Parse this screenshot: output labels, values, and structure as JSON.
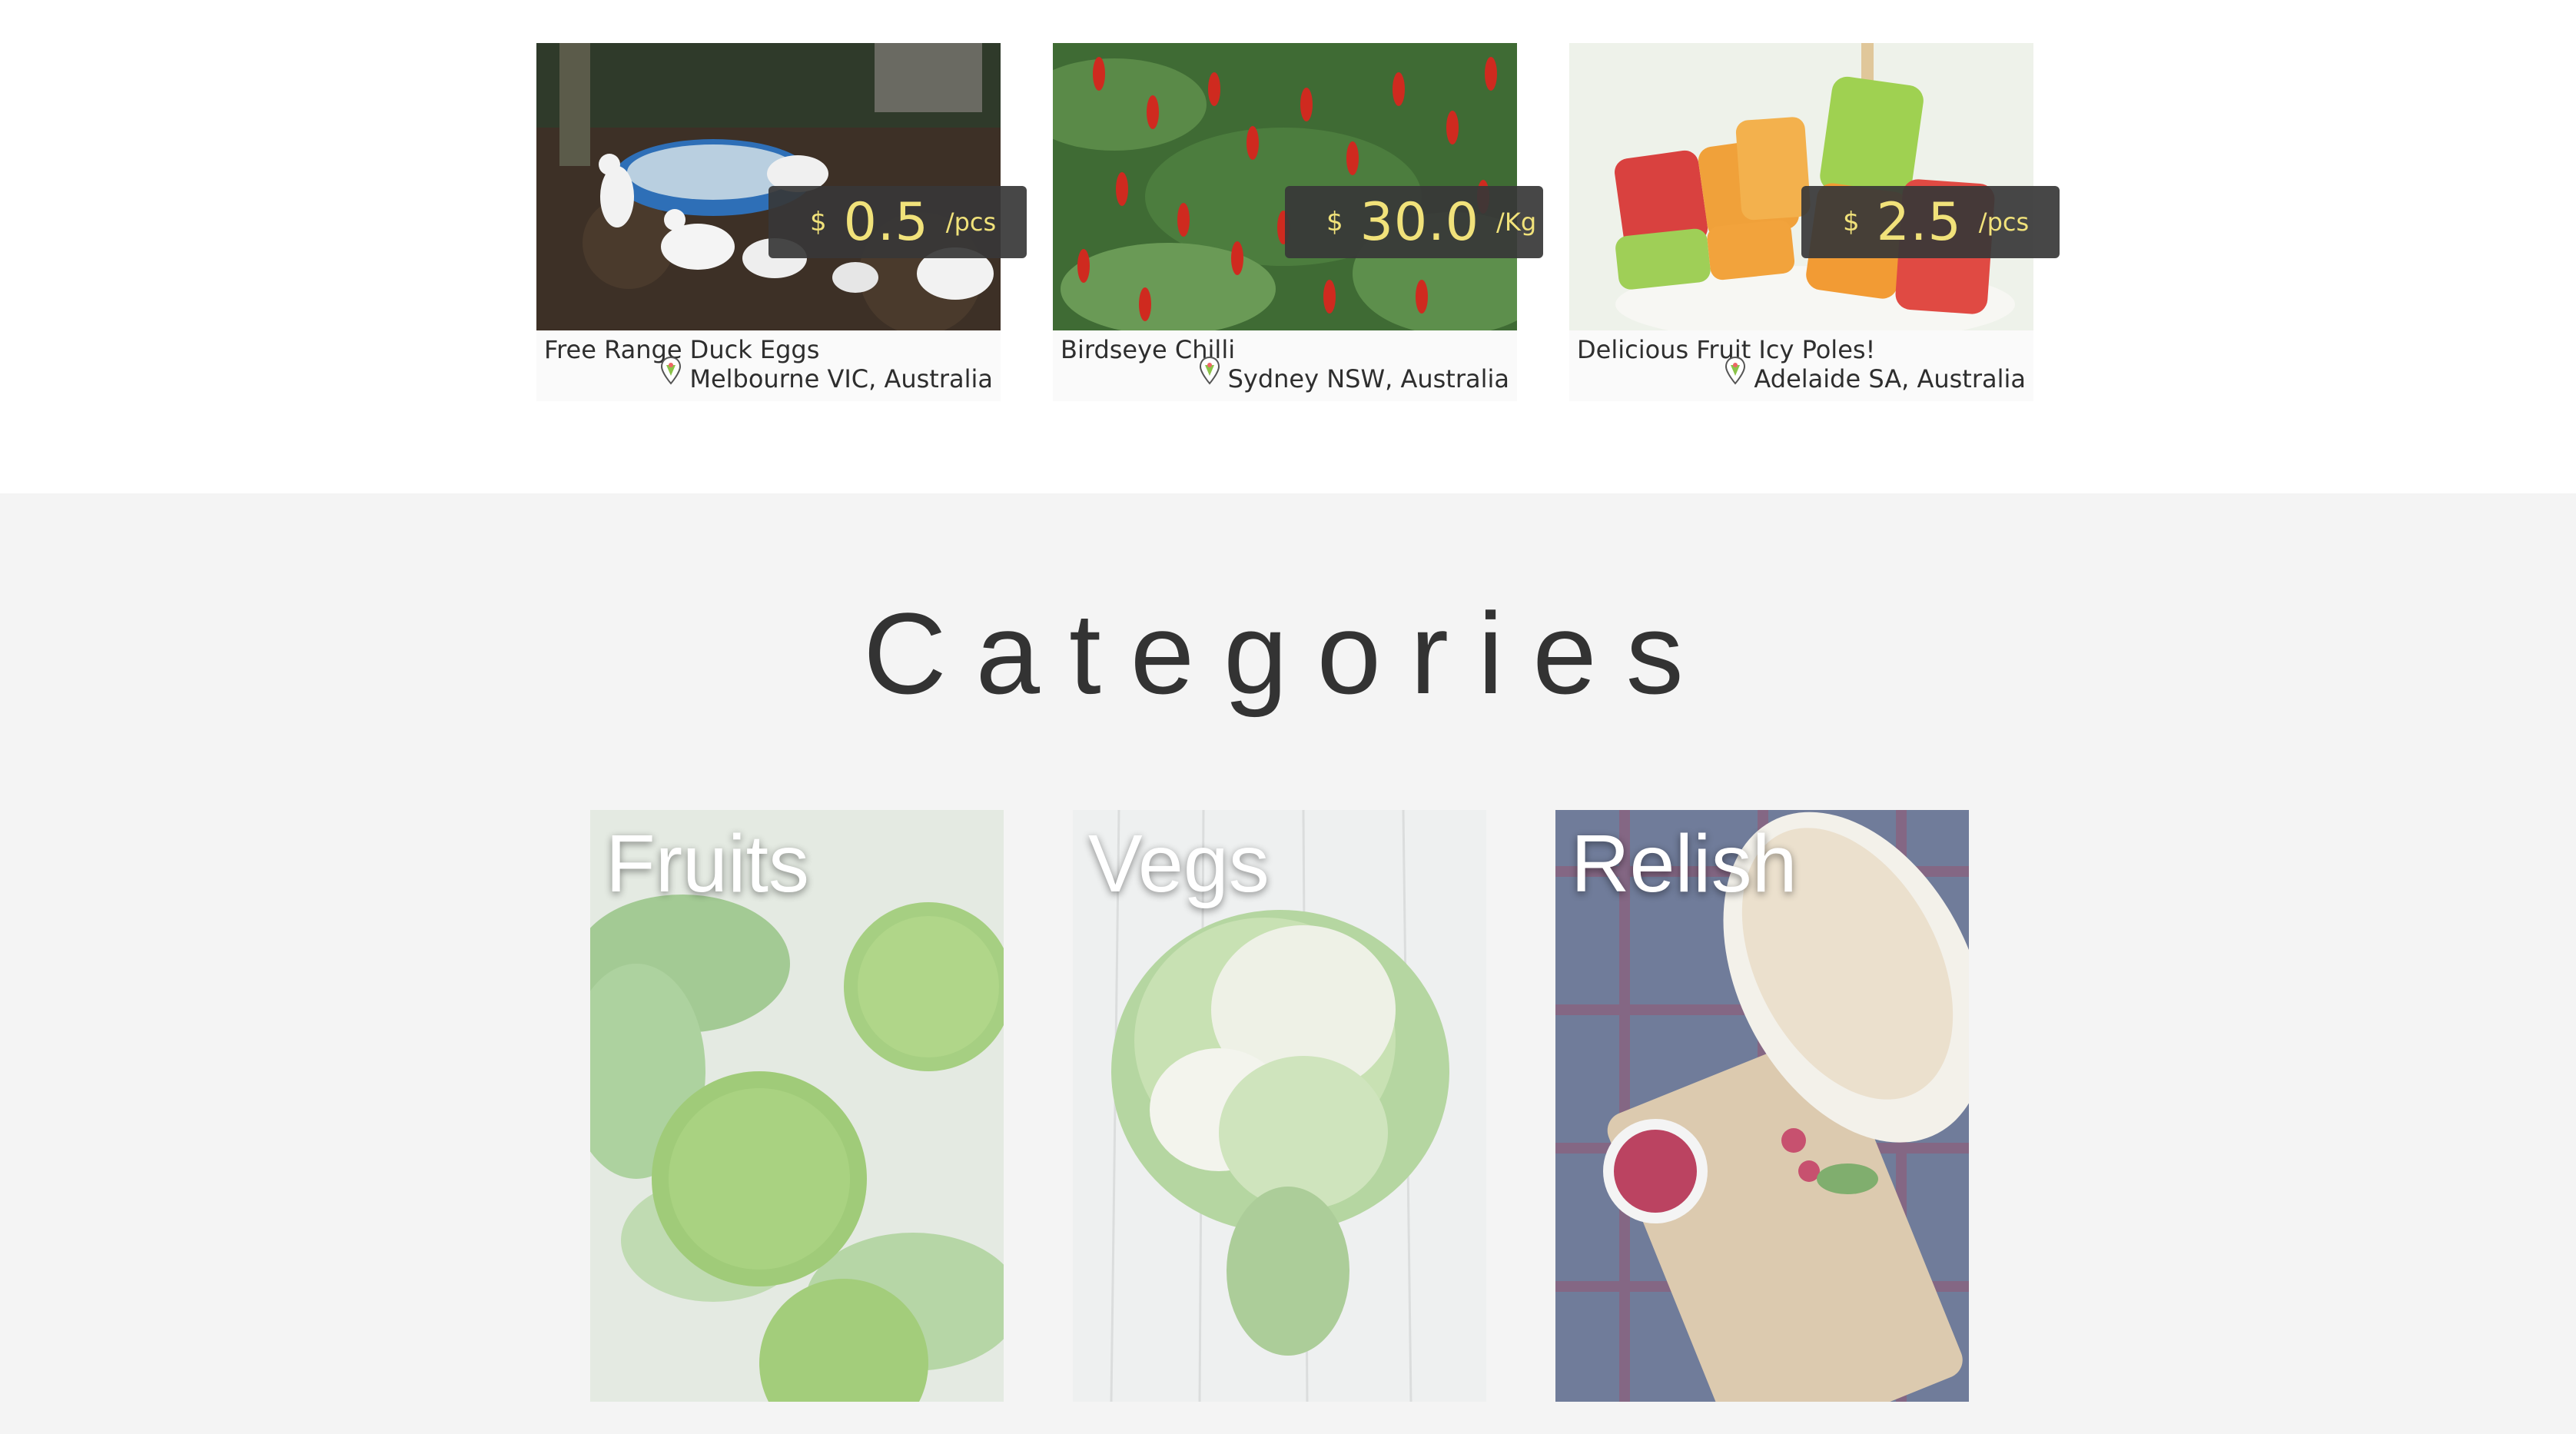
{
  "products": [
    {
      "title": "Free Range Duck Eggs",
      "location": "Melbourne VIC, Australia",
      "currency": "$",
      "price": "0.5",
      "unit": "/pcs"
    },
    {
      "title": "Birdseye Chilli",
      "location": "Sydney NSW, Australia",
      "currency": "$",
      "price": "30.0",
      "unit": "/Kg"
    },
    {
      "title": "Delicious Fruit Icy Poles!",
      "location": "Adelaide SA, Australia",
      "currency": "$",
      "price": "2.5",
      "unit": "/pcs"
    }
  ],
  "categories_section": {
    "heading": "Categories",
    "items": [
      {
        "label": "Fruits"
      },
      {
        "label": "Vegs"
      },
      {
        "label": "Relish"
      }
    ]
  },
  "colors": {
    "price_text": "#f1e27a",
    "price_bg": "#373737",
    "section_bg": "#f4f4f4",
    "pin_accent": "#8bc34a"
  }
}
